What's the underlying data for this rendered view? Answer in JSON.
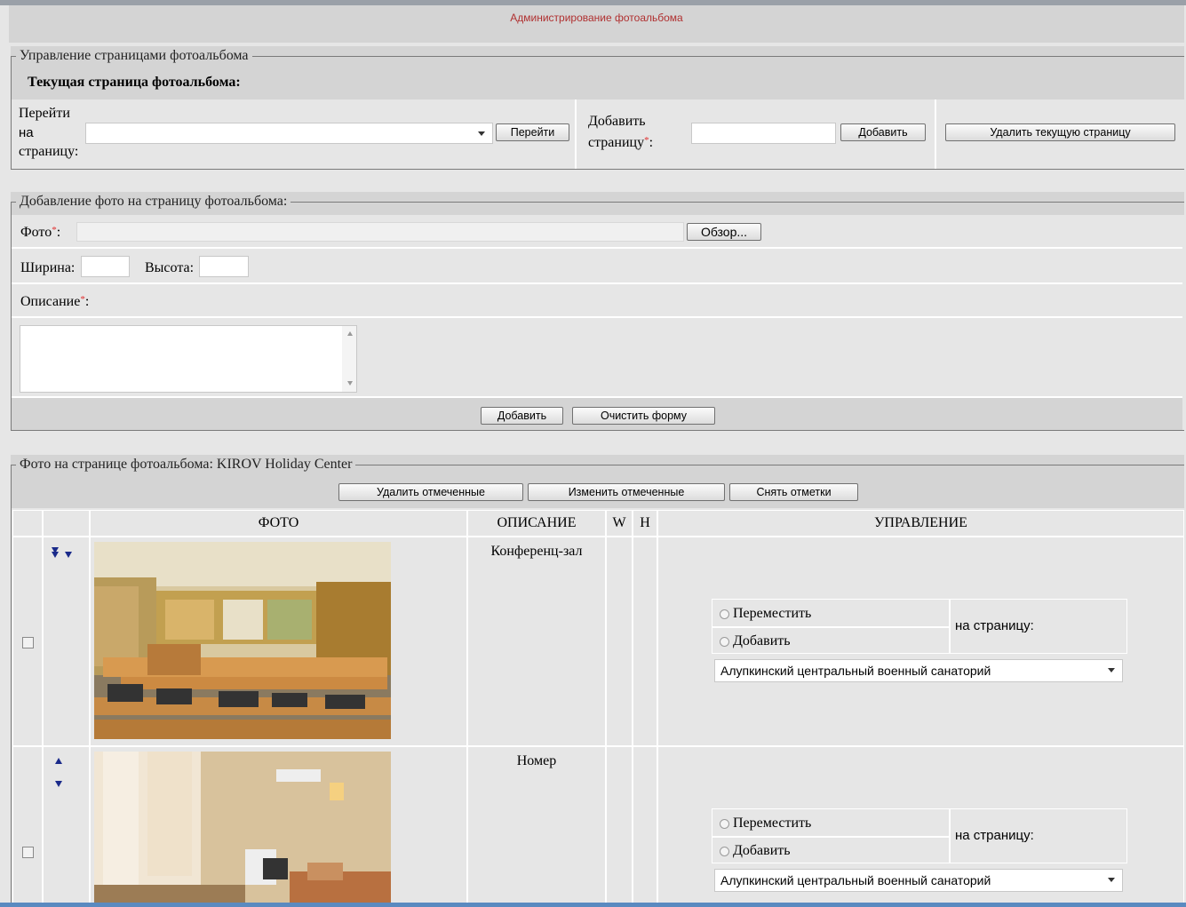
{
  "header": {
    "title": "Администрирование фотоальбома"
  },
  "pages_section": {
    "legend": "Управление страницами фотоальбома",
    "current_page_label": "Текущая страница фотоальбома:",
    "goto_label_1": "Перейти",
    "goto_label_2": "на",
    "goto_label_3": "страницу:",
    "goto_select_value": "",
    "goto_button": "Перейти",
    "add_label_1": "Добавить",
    "add_label_2": "страницу",
    "add_required_mark": "*",
    "add_colon": ":",
    "add_input_value": "",
    "add_button": "Добавить",
    "delete_button": "Удалить текущую страницу"
  },
  "add_photo_section": {
    "legend": "Добавление фото на страницу фотоальбома:",
    "photo_label": "Фото",
    "required_mark": "*",
    "colon": ":",
    "browse_button": "Обзор...",
    "width_label": "Ширина:",
    "height_label": "Высота:",
    "description_label": "Описание",
    "add_button": "Добавить",
    "clear_button": "Очистить форму"
  },
  "photos_section": {
    "legend": "Фото на странице фотоальбома: KIROV Holiday Center",
    "delete_checked": "Удалить отмеченные",
    "edit_checked": "Изменить отмеченные",
    "uncheck_all": "Снять отметки",
    "columns": {
      "photo": "ФОТО",
      "description": "ОПИСАНИЕ",
      "w": "W",
      "h": "H",
      "control": "УПРАВЛЕНИЕ"
    },
    "rows": [
      {
        "description": "Конференц-зал",
        "move_label": "Переместить",
        "add_label": "Добавить",
        "to_page_label": "на страницу:",
        "select_value": "Алупкинский центральный военный санаторий"
      },
      {
        "description": "Номер",
        "move_label": "Переместить",
        "add_label": "Добавить",
        "to_page_label": "на страницу:",
        "select_value": "Алупкинский центральный военный санаторий"
      }
    ]
  },
  "colors": {
    "header_text": "#b03030",
    "arrow": "#1a2a8a",
    "required": "#e03030"
  }
}
